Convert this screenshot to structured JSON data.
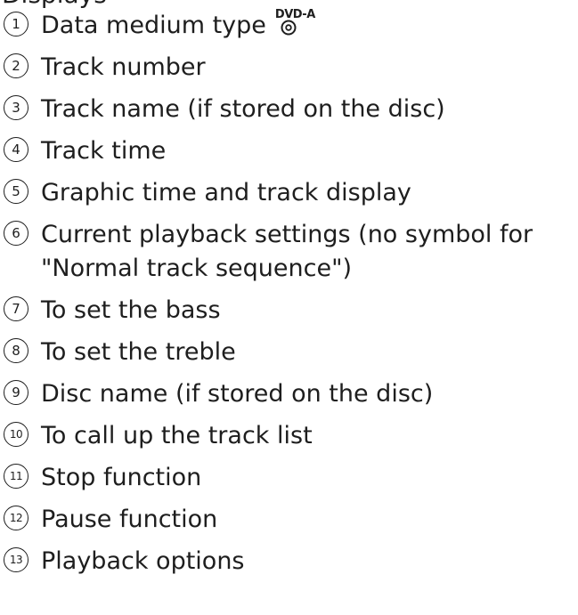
{
  "top_cut_text": "Displays",
  "dvd_label": "DVD-A",
  "items": [
    {
      "num": "1",
      "text": "Data medium type"
    },
    {
      "num": "2",
      "text": "Track number"
    },
    {
      "num": "3",
      "text": "Track name (if stored on the disc)"
    },
    {
      "num": "4",
      "text": "Track time"
    },
    {
      "num": "5",
      "text": "Graphic time and track display"
    },
    {
      "num": "6",
      "text": "Current playback settings (no symbol for",
      "text2": "\"Normal track sequence\")"
    },
    {
      "num": "7",
      "text": "To set the bass"
    },
    {
      "num": "8",
      "text": "To set the treble"
    },
    {
      "num": "9",
      "text": "Disc name (if stored on the disc)"
    },
    {
      "num": "10",
      "text": "To call up the track list"
    },
    {
      "num": "11",
      "text": "Stop function"
    },
    {
      "num": "12",
      "text": "Pause function"
    },
    {
      "num": "13",
      "text": "Playback options"
    }
  ]
}
